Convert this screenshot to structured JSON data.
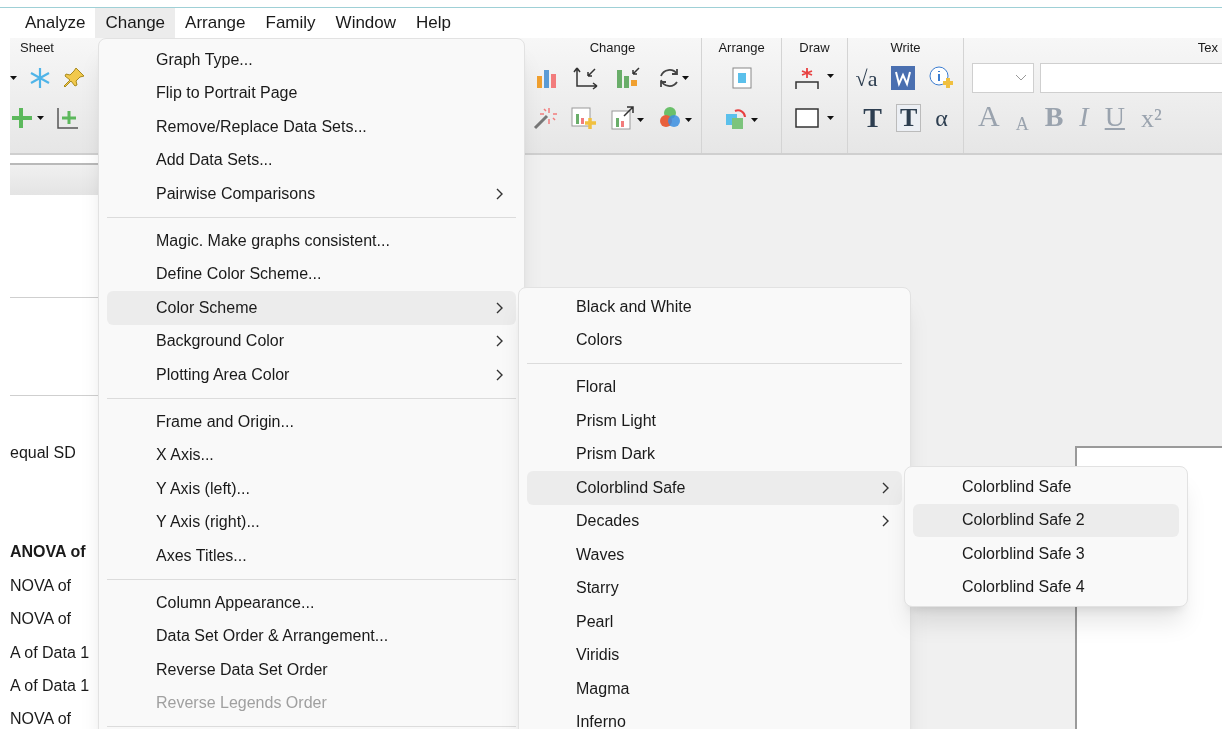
{
  "menubar": {
    "items": [
      {
        "label": "Analyze",
        "selected": false
      },
      {
        "label": "Change",
        "selected": true
      },
      {
        "label": "Arrange",
        "selected": false
      },
      {
        "label": "Family",
        "selected": false
      },
      {
        "label": "Window",
        "selected": false
      },
      {
        "label": "Help",
        "selected": false
      }
    ]
  },
  "toolbar": {
    "groups": [
      {
        "label": "Sheet"
      },
      {
        "label": "Change"
      },
      {
        "label": "Arrange"
      },
      {
        "label": "Draw"
      },
      {
        "label": "Write",
        "glyphs": [
          "√a",
          "T",
          "T",
          "α"
        ],
        "disabled": false
      },
      {
        "label": "Tex",
        "glyphs": [
          "A",
          "A",
          "B",
          "I",
          "U",
          "x²"
        ],
        "disabled": true
      }
    ]
  },
  "sheet": {
    "lines": [
      {
        "text": "equal SD",
        "bold": false
      },
      {
        "text": "ANOVA of",
        "bold": true
      },
      {
        "text": "NOVA of",
        "bold": false
      },
      {
        "text": "NOVA of",
        "bold": false
      },
      {
        "text": "A of Data 1",
        "bold": false
      },
      {
        "text": "A of Data 1",
        "bold": false
      },
      {
        "text": "NOVA of",
        "bold": false
      }
    ]
  },
  "change_menu": {
    "items": [
      {
        "kind": "item",
        "label": "Graph Type...",
        "has_submenu": false,
        "disabled": false,
        "selected": false
      },
      {
        "kind": "item",
        "label": "Flip to Portrait Page",
        "has_submenu": false,
        "disabled": false,
        "selected": false
      },
      {
        "kind": "item",
        "label": "Remove/Replace Data Sets...",
        "has_submenu": false,
        "disabled": false,
        "selected": false
      },
      {
        "kind": "item",
        "label": "Add Data Sets...",
        "has_submenu": false,
        "disabled": false,
        "selected": false
      },
      {
        "kind": "item",
        "label": "Pairwise Comparisons",
        "has_submenu": true,
        "disabled": false,
        "selected": false
      },
      {
        "kind": "separator"
      },
      {
        "kind": "item",
        "label": "Magic. Make graphs consistent...",
        "has_submenu": false,
        "disabled": false,
        "selected": false
      },
      {
        "kind": "item",
        "label": "Define Color Scheme...",
        "has_submenu": false,
        "disabled": false,
        "selected": false
      },
      {
        "kind": "item",
        "label": "Color Scheme",
        "has_submenu": true,
        "disabled": false,
        "selected": true
      },
      {
        "kind": "item",
        "label": "Background Color",
        "has_submenu": true,
        "disabled": false,
        "selected": false
      },
      {
        "kind": "item",
        "label": "Plotting Area Color",
        "has_submenu": true,
        "disabled": false,
        "selected": false
      },
      {
        "kind": "separator"
      },
      {
        "kind": "item",
        "label": "Frame and Origin...",
        "has_submenu": false,
        "disabled": false,
        "selected": false
      },
      {
        "kind": "item",
        "label": "X Axis...",
        "has_submenu": false,
        "disabled": false,
        "selected": false
      },
      {
        "kind": "item",
        "label": "Y Axis (left)...",
        "has_submenu": false,
        "disabled": false,
        "selected": false
      },
      {
        "kind": "item",
        "label": "Y Axis (right)...",
        "has_submenu": false,
        "disabled": false,
        "selected": false
      },
      {
        "kind": "item",
        "label": "Axes Titles...",
        "has_submenu": false,
        "disabled": false,
        "selected": false
      },
      {
        "kind": "separator"
      },
      {
        "kind": "item",
        "label": "Column Appearance...",
        "has_submenu": false,
        "disabled": false,
        "selected": false
      },
      {
        "kind": "item",
        "label": "Data Set Order & Arrangement...",
        "has_submenu": false,
        "disabled": false,
        "selected": false
      },
      {
        "kind": "item",
        "label": "Reverse Data Set Order",
        "has_submenu": false,
        "disabled": false,
        "selected": false
      },
      {
        "kind": "item",
        "label": "Reverse Legends Order",
        "has_submenu": false,
        "disabled": true,
        "selected": false
      },
      {
        "kind": "separator"
      }
    ]
  },
  "color_scheme_menu": {
    "items": [
      {
        "kind": "item",
        "label": "Black and White",
        "has_submenu": false,
        "selected": false
      },
      {
        "kind": "item",
        "label": "Colors",
        "has_submenu": false,
        "selected": false
      },
      {
        "kind": "separator"
      },
      {
        "kind": "item",
        "label": "Floral",
        "has_submenu": false,
        "selected": false
      },
      {
        "kind": "item",
        "label": "Prism Light",
        "has_submenu": false,
        "selected": false
      },
      {
        "kind": "item",
        "label": "Prism Dark",
        "has_submenu": false,
        "selected": false
      },
      {
        "kind": "item",
        "label": "Colorblind Safe",
        "has_submenu": true,
        "selected": true
      },
      {
        "kind": "item",
        "label": "Decades",
        "has_submenu": true,
        "selected": false
      },
      {
        "kind": "item",
        "label": "Waves",
        "has_submenu": false,
        "selected": false
      },
      {
        "kind": "item",
        "label": "Starry",
        "has_submenu": false,
        "selected": false
      },
      {
        "kind": "item",
        "label": "Pearl",
        "has_submenu": false,
        "selected": false
      },
      {
        "kind": "item",
        "label": "Viridis",
        "has_submenu": false,
        "selected": false
      },
      {
        "kind": "item",
        "label": "Magma",
        "has_submenu": false,
        "selected": false
      },
      {
        "kind": "item",
        "label": "Inferno",
        "has_submenu": false,
        "selected": false
      }
    ]
  },
  "colorblind_menu": {
    "items": [
      {
        "kind": "item",
        "label": "Colorblind Safe",
        "has_submenu": false,
        "selected": false
      },
      {
        "kind": "item",
        "label": "Colorblind Safe 2",
        "has_submenu": false,
        "selected": true
      },
      {
        "kind": "item",
        "label": "Colorblind Safe 3",
        "has_submenu": false,
        "selected": false
      },
      {
        "kind": "item",
        "label": "Colorblind Safe 4",
        "has_submenu": false,
        "selected": false
      }
    ]
  }
}
